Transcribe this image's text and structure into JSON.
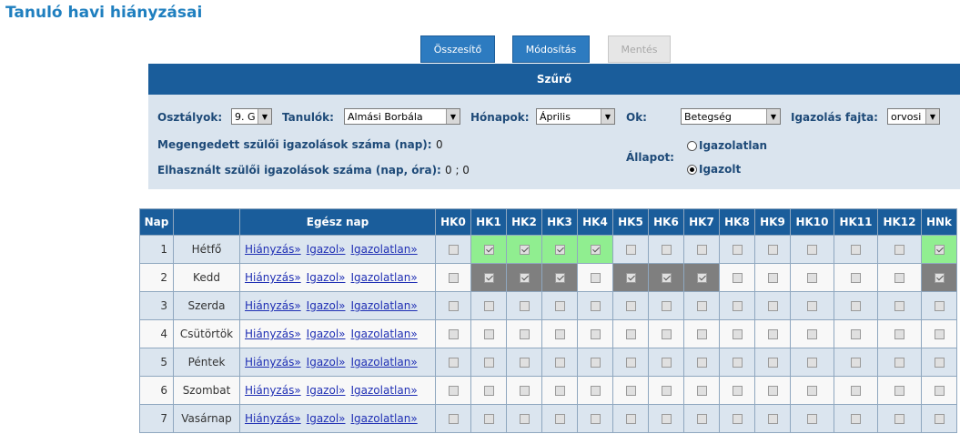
{
  "page": {
    "title": "Tanuló havi hiányzásai"
  },
  "toolbar": {
    "summary_label": "Összesítő",
    "edit_label": "Módosítás",
    "save_label": "Mentés"
  },
  "filter": {
    "header": "Szűrő",
    "classes_label": "Osztályok:",
    "classes_value": "9. G",
    "students_label": "Tanulók:",
    "students_value": "Almási Borbála",
    "months_label": "Hónapok:",
    "months_value": "Április",
    "reason_label": "Ok:",
    "reason_value": "Betegség",
    "justification_type_label": "Igazolás fajta:",
    "justification_type_value": "orvosi",
    "allowed_label": "Megengedett szülői igazolások száma (nap):",
    "allowed_value": "0",
    "used_label": "Elhasznált szülői igazolások száma (nap, óra):",
    "used_value": "0 ; 0",
    "status_label": "Állapot:",
    "status_unjustified": "Igazolatlan",
    "status_justified": "Igazolt",
    "status_selected": "Igazolt"
  },
  "table": {
    "headers": [
      "Nap",
      "",
      "Egész nap",
      "HK0",
      "HK1",
      "HK2",
      "HK3",
      "HK4",
      "HK5",
      "HK6",
      "HK7",
      "HK8",
      "HK9",
      "HK10",
      "HK11",
      "HK12",
      "HNk"
    ],
    "link_absence": "Hiányzás»",
    "link_justify": "Igazol»",
    "link_unjustified": "Igazolatlan»",
    "rows": [
      {
        "num": "1",
        "day": "Hétfő",
        "checked": [
          0,
          1,
          1,
          1,
          1,
          0,
          0,
          0,
          0,
          0,
          0,
          0,
          0,
          1
        ],
        "highlight": [
          "",
          "g",
          "g",
          "g",
          "g",
          "",
          "",
          "",
          "",
          "",
          "",
          "",
          "",
          "g"
        ]
      },
      {
        "num": "2",
        "day": "Kedd",
        "checked": [
          0,
          1,
          1,
          1,
          0,
          1,
          1,
          1,
          0,
          0,
          0,
          0,
          0,
          1
        ],
        "highlight": [
          "",
          "d",
          "d",
          "d",
          "",
          "d",
          "d",
          "d",
          "",
          "",
          "",
          "",
          "",
          "d"
        ]
      },
      {
        "num": "3",
        "day": "Szerda",
        "checked": [
          0,
          0,
          0,
          0,
          0,
          0,
          0,
          0,
          0,
          0,
          0,
          0,
          0,
          0
        ],
        "highlight": [
          "",
          "",
          "",
          "",
          "",
          "",
          "",
          "",
          "",
          "",
          "",
          "",
          "",
          ""
        ]
      },
      {
        "num": "4",
        "day": "Csütörtök",
        "checked": [
          0,
          0,
          0,
          0,
          0,
          0,
          0,
          0,
          0,
          0,
          0,
          0,
          0,
          0
        ],
        "highlight": [
          "",
          "",
          "",
          "",
          "",
          "",
          "",
          "",
          "",
          "",
          "",
          "",
          "",
          ""
        ]
      },
      {
        "num": "5",
        "day": "Péntek",
        "checked": [
          0,
          0,
          0,
          0,
          0,
          0,
          0,
          0,
          0,
          0,
          0,
          0,
          0,
          0
        ],
        "highlight": [
          "",
          "",
          "",
          "",
          "",
          "",
          "",
          "",
          "",
          "",
          "",
          "",
          "",
          ""
        ]
      },
      {
        "num": "6",
        "day": "Szombat",
        "checked": [
          0,
          0,
          0,
          0,
          0,
          0,
          0,
          0,
          0,
          0,
          0,
          0,
          0,
          0
        ],
        "highlight": [
          "",
          "",
          "",
          "",
          "",
          "",
          "",
          "",
          "",
          "",
          "",
          "",
          "",
          ""
        ]
      },
      {
        "num": "7",
        "day": "Vasárnap",
        "checked": [
          0,
          0,
          0,
          0,
          0,
          0,
          0,
          0,
          0,
          0,
          0,
          0,
          0,
          0
        ],
        "highlight": [
          "",
          "",
          "",
          "",
          "",
          "",
          "",
          "",
          "",
          "",
          "",
          "",
          "",
          ""
        ]
      }
    ]
  },
  "colors": {
    "header_blue": "#1a5d9b",
    "title_blue": "#1f7fbf",
    "row_odd": "#dbe5ef",
    "row_even": "#f8f8f8",
    "highlight_justified": "#90ee90",
    "highlight_dark": "#7f7f7f"
  }
}
